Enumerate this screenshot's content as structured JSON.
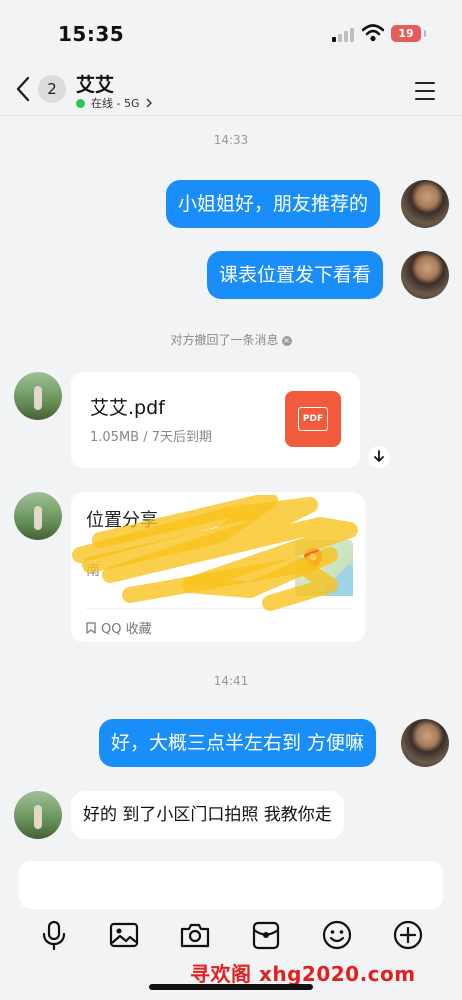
{
  "status_bar": {
    "time": "15:35",
    "battery": "19"
  },
  "header": {
    "back_badge": "2",
    "contact_name": "艾艾",
    "presence": "在线 - 5G"
  },
  "chat": {
    "timestamp_1": "14:33",
    "msg_out_1": "小姐姐好，朋友推荐的",
    "msg_out_2": "课表位置发下看看",
    "recall_notice": "对方撤回了一条消息",
    "file": {
      "name": "艾艾.pdf",
      "meta": "1.05MB / 7天后到期",
      "icon_label": "PDF"
    },
    "location": {
      "title": "位置分享",
      "address_fragment": "南",
      "source": "QQ 收藏"
    },
    "timestamp_2": "14:41",
    "msg_out_3": "好，大概三点半左右到 方便嘛",
    "msg_in_1": "好的 到了小区门口拍照 我教你走"
  },
  "input": {
    "placeholder": ""
  },
  "toolbar": {
    "icons": [
      "microphone-icon",
      "image-icon",
      "camera-icon",
      "red-packet-icon",
      "emoji-icon",
      "plus-icon"
    ]
  },
  "watermark": "寻欢阁 xhg2020.com",
  "colors": {
    "accent": "#1a8ef8",
    "background": "#f2f3f5",
    "pdf": "#f15a3a",
    "online": "#2ec55b",
    "watermark": "#e32020"
  }
}
